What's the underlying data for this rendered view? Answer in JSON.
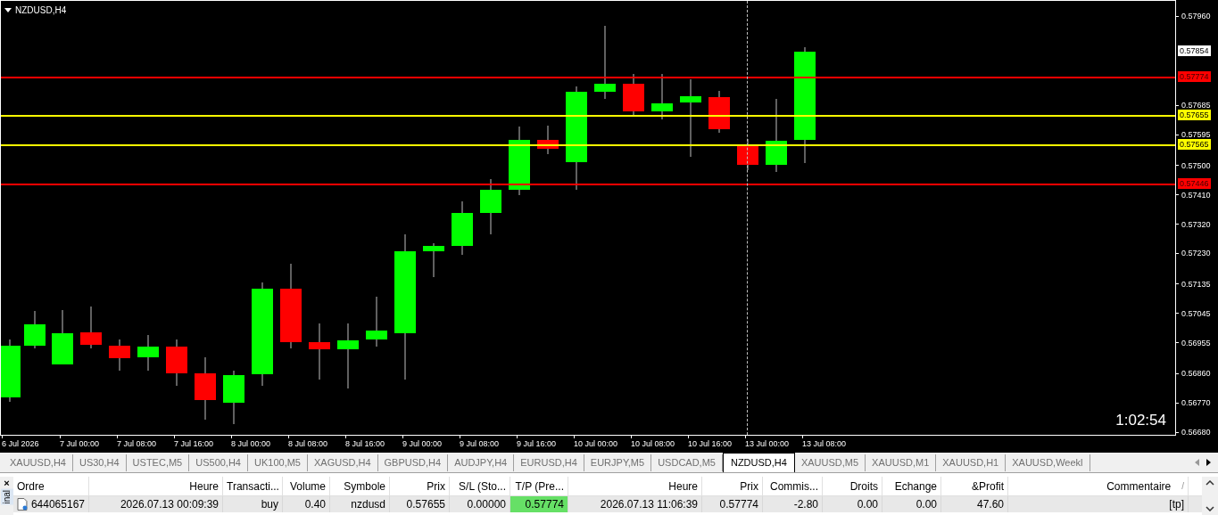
{
  "chart": {
    "title": "NZDUSD,H4",
    "timer": "1:02:54",
    "price_ticks": [
      "0.57960",
      "0.57685",
      "0.57595",
      "0.57500",
      "0.57410",
      "0.57320",
      "0.57230",
      "0.57135",
      "0.57045",
      "0.56955",
      "0.56860",
      "0.56770",
      "0.56680"
    ],
    "levels": [
      {
        "label": "0.57774",
        "color": "#ff0000"
      },
      {
        "label": "0.57655",
        "color": "#ffff00"
      },
      {
        "label": "0.57565",
        "color": "#ffff00"
      },
      {
        "label": "0.57446",
        "color": "#ff0000"
      }
    ],
    "bid_label": "0.57854",
    "time_labels": [
      "6 Jul 2026",
      "7 Jul 00:00",
      "7 Jul 08:00",
      "7 Jul 16:00",
      "8 Jul 00:00",
      "8 Jul 08:00",
      "8 Jul 16:00",
      "9 Jul 00:00",
      "9 Jul 08:00",
      "9 Jul 16:00",
      "10 Jul 00:00",
      "10 Jul 08:00",
      "10 Jul 16:00",
      "13 Jul 00:00",
      "13 Jul 08:00"
    ]
  },
  "tabs": [
    {
      "label": "XAUUSD,H4",
      "selected": false
    },
    {
      "label": "US30,H4",
      "selected": false
    },
    {
      "label": "USTEC,M5",
      "selected": false
    },
    {
      "label": "US500,H4",
      "selected": false
    },
    {
      "label": "UK100,M5",
      "selected": false
    },
    {
      "label": "XAGUSD,H4",
      "selected": false
    },
    {
      "label": "GBPUSD,H4",
      "selected": false
    },
    {
      "label": "AUDJPY,H4",
      "selected": false
    },
    {
      "label": "EURUSD,H4",
      "selected": false
    },
    {
      "label": "EURJPY,M5",
      "selected": false
    },
    {
      "label": "USDCAD,M5",
      "selected": false
    },
    {
      "label": "NZDUSD,H4",
      "selected": true
    },
    {
      "label": "XAUUSD,M5",
      "selected": false
    },
    {
      "label": "XAUUSD,M1",
      "selected": false
    },
    {
      "label": "XAUUSD,H1",
      "selected": false
    },
    {
      "label": "XAUUSD,Weekl",
      "selected": false
    }
  ],
  "terminal": {
    "close": "×",
    "side_label": "inal",
    "sort_mark": "/",
    "columns": [
      "Ordre",
      "Heure",
      "Transacti...",
      "Volume",
      "Symbole",
      "Prix",
      "S/L (Sto...",
      "T/P (Pre...",
      "Heure",
      "Prix",
      "Commis...",
      "Droits",
      "Echange",
      "&Profit",
      "Commentaire"
    ],
    "rows": [
      {
        "cells": [
          "644065167",
          "2026.07.13 00:09:39",
          "buy",
          "0.40",
          "nzdusd",
          "0.57655",
          "0.00000",
          "0.57774",
          "2026.07.13 11:06:39",
          "0.57774",
          "-2.80",
          "0.00",
          "0.00",
          "47.60",
          "[tp]"
        ],
        "tp_hit": true
      }
    ]
  }
}
